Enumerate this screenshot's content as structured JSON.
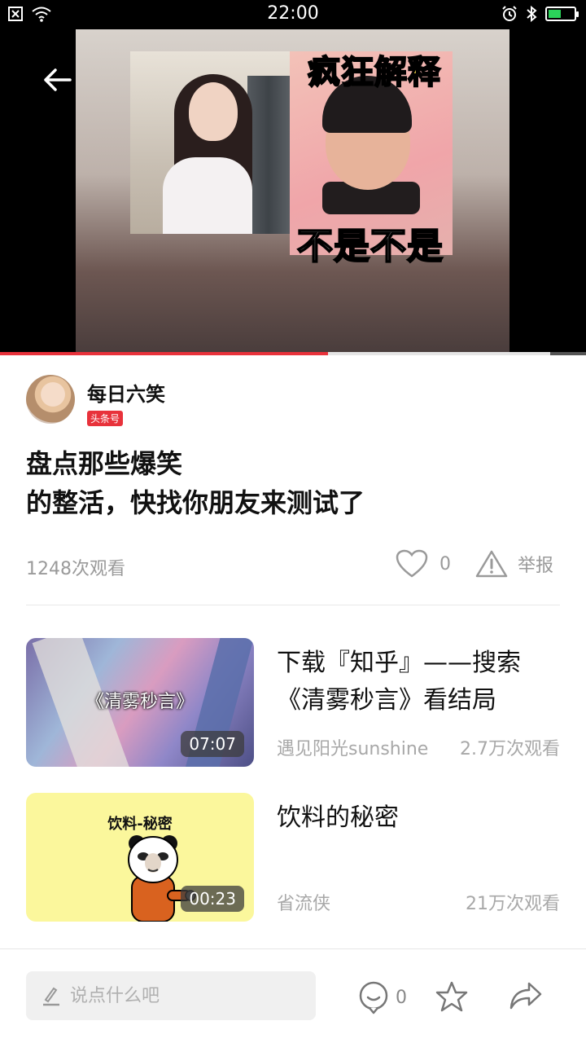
{
  "status_bar": {
    "time": "22:00",
    "battery_level": 0.5
  },
  "video": {
    "overlay_top": "疯狂解释",
    "overlay_bottom": "不是不是",
    "progress": 0.56
  },
  "author": {
    "name": "每日六笑",
    "badge": "头条号"
  },
  "title": {
    "line1": "盘点那些爆笑",
    "line2": "的整活，快找你朋友来测试了"
  },
  "meta": {
    "views": "1248次观看",
    "likes": "0",
    "report_label": "举报"
  },
  "related": [
    {
      "thumb_caption": "《清雾秒言》",
      "duration": "07:07",
      "title": "下载『知乎』——搜索《清雾秒言》看结局",
      "source": "遇见阳光sunshine",
      "views": "2.7万次观看"
    },
    {
      "thumb_caption": "饮料-秘密",
      "duration": "00:23",
      "title": "饮料的秘密",
      "source": "省流侠",
      "views": "21万次观看"
    }
  ],
  "bottom_bar": {
    "placeholder": "说点什么吧",
    "comment_count": "0"
  },
  "colors": {
    "accent": "#e8323b",
    "muted_text": "#9a9a9a"
  }
}
